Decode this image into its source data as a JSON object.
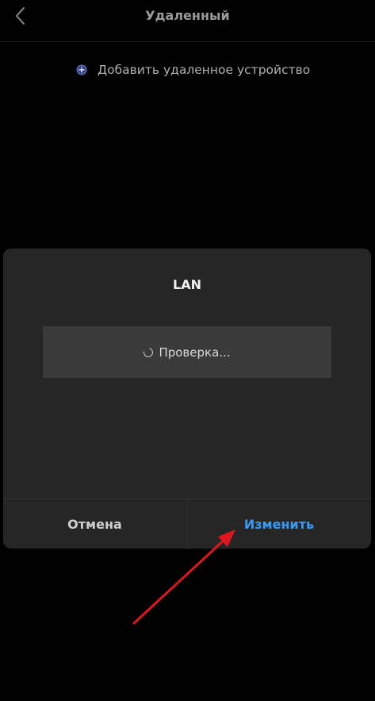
{
  "header": {
    "title": "Удаленный"
  },
  "add_remote": {
    "label": "Добавить удаленное устройство"
  },
  "dialog": {
    "title": "LAN",
    "status_text": "Проверка...",
    "cancel_label": "Отмена",
    "confirm_label": "Изменить"
  },
  "colors": {
    "background": "#000000",
    "dialog_background": "#262626",
    "status_box": "#3a3a3a",
    "accent": "#3b9af0",
    "annotation_arrow": "#e0161d"
  },
  "icons": {
    "back": "chevron-left-icon",
    "add": "plus-circle-icon",
    "status": "spinner-icon",
    "annotation": "red-arrow-icon"
  }
}
